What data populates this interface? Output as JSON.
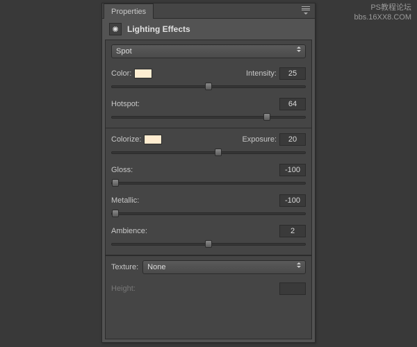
{
  "watermark": {
    "line1": "PS教程论坛",
    "line2": "bbs.16XX8.COM"
  },
  "panel": {
    "tab": "Properties",
    "title": "Lighting Effects",
    "light_type": "Spot",
    "color": {
      "label": "Color:",
      "swatch": "#fdeed2"
    },
    "intensity": {
      "label": "Intensity:",
      "value": "25",
      "pos": 50
    },
    "hotspot": {
      "label": "Hotspot:",
      "value": "64",
      "pos": 80
    },
    "colorize": {
      "label": "Colorize:",
      "swatch": "#feecd0"
    },
    "exposure": {
      "label": "Exposure:",
      "value": "20",
      "pos": 55
    },
    "gloss": {
      "label": "Gloss:",
      "value": "-100",
      "pos": 2
    },
    "metallic": {
      "label": "Metallic:",
      "value": "-100",
      "pos": 2
    },
    "ambience": {
      "label": "Ambience:",
      "value": "2",
      "pos": 50
    },
    "texture": {
      "label": "Texture:",
      "value": "None"
    },
    "height": {
      "label": "Height:",
      "value": ""
    }
  }
}
